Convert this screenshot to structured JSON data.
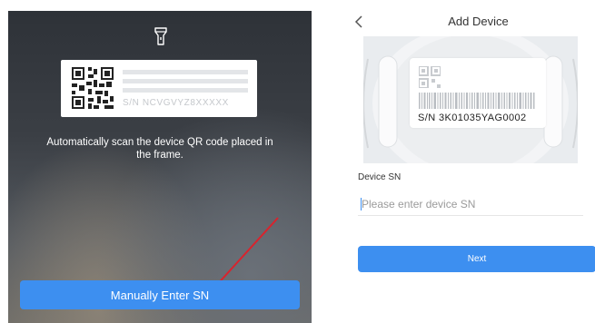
{
  "scanner": {
    "flashlight_icon": "flashlight-icon",
    "sample_sn": "S/N  NCVGVYZ8XXXXX",
    "hint": "Automatically scan the device QR code placed in the frame.",
    "manual_button_label": "Manually Enter SN",
    "annotation_color": "#d9232d"
  },
  "add_device": {
    "back_icon": "chevron-left-icon",
    "title": "Add Device",
    "device_sn_label": "S/N  3K01035YAG0002",
    "field_label": "Device SN",
    "input_value": "",
    "input_placeholder": "Please enter device SN",
    "next_button_label": "Next"
  },
  "colors": {
    "accent": "#3d8ff0"
  }
}
